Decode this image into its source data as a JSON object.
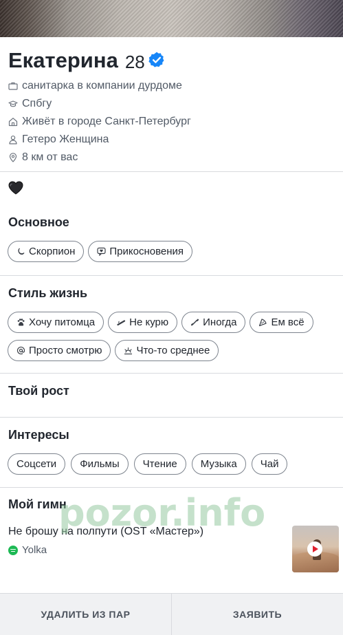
{
  "profile": {
    "name": "Екатерина",
    "age": "28",
    "job": "санитарка в компании дурдоме",
    "school": "Спбгу",
    "city": "Живёт в городе Санкт-Петербург",
    "orientation": "Гетеро Женщина",
    "distance": "8 км от вас"
  },
  "sections": {
    "basics": {
      "title": "Основное",
      "chips": [
        {
          "icon": "moon-icon",
          "label": "Скорпион"
        },
        {
          "icon": "chat-heart-icon",
          "label": "Прикосновения"
        }
      ]
    },
    "lifestyle": {
      "title": "Стиль жизнь",
      "chips": [
        {
          "icon": "paw-icon",
          "label": "Хочу питомца"
        },
        {
          "icon": "cigarette-icon",
          "label": "Не курю"
        },
        {
          "icon": "dumbbell-icon",
          "label": "Иногда"
        },
        {
          "icon": "pizza-icon",
          "label": "Ем всё"
        },
        {
          "icon": "at-icon",
          "label": "Просто смотрю"
        },
        {
          "icon": "sunrise-icon",
          "label": "Что-то среднее"
        }
      ]
    },
    "height": {
      "title": "Твой рост"
    },
    "interests": {
      "title": "Интересы",
      "chips": [
        "Соцсети",
        "Фильмы",
        "Чтение",
        "Музыка",
        "Чай"
      ]
    },
    "anthem": {
      "title": "Мой гимн",
      "song": "Не брошу на полпути (OST «Мастер»)",
      "artist": "Yolka"
    }
  },
  "watermark": "pozor.info",
  "footer": {
    "remove": "УДАЛИТЬ ИЗ ПАР",
    "report": "ЗАЯВИТЬ"
  },
  "colors": {
    "verified": "#1786f8",
    "text": "#21262e",
    "secondary": "#505965",
    "spotify": "#1db954"
  }
}
